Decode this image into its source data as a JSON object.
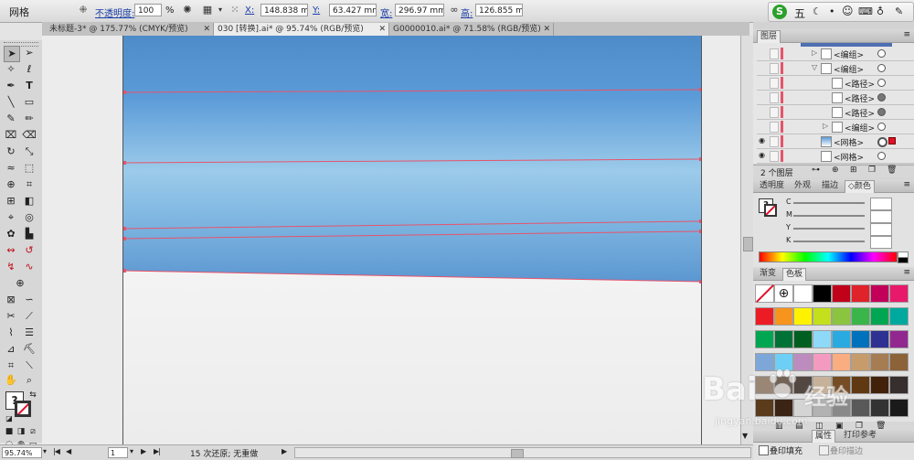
{
  "control_bar": {
    "tool_name": "网格",
    "opacity_label": "不透明度:",
    "opacity_value": "100",
    "percent_sign": "%",
    "x_label": "X:",
    "x_value": "148.838 mm",
    "y_label": "Y:",
    "y_value": "63.427 mm",
    "width_label": "宽:",
    "width_value": "296.97 mm",
    "height_label": "高:",
    "height_value": "126.855 mm"
  },
  "ime_bar": {
    "logo": "S",
    "mode": "五",
    "icons": [
      "moon-icon",
      "dot-icon",
      "smiley-icon",
      "keyboard-icon",
      "shirt-icon",
      "wrench-icon"
    ]
  },
  "document_tabs": [
    {
      "title": "未标题-3* @ 175.77% (CMYK/预览)",
      "active": false
    },
    {
      "title": "030 [转换].ai* @ 95.74% (RGB/预览)",
      "active": true
    },
    {
      "title": "G0000010.ai* @ 71.58% (RGB/预览)",
      "active": false
    }
  ],
  "layers_panel": {
    "title": "图层",
    "rows": [
      {
        "name": "<编组>",
        "indent": 1,
        "twirl": "▷",
        "visible": false,
        "target": "ring"
      },
      {
        "name": "<编组>",
        "indent": 1,
        "twirl": "▽",
        "visible": false,
        "target": "ring"
      },
      {
        "name": "<路径>",
        "indent": 2,
        "twirl": "",
        "visible": false,
        "target": "ring"
      },
      {
        "name": "<路径>",
        "indent": 2,
        "twirl": "",
        "visible": false,
        "target": "filled"
      },
      {
        "name": "<路径>",
        "indent": 2,
        "twirl": "",
        "visible": false,
        "target": "filled"
      },
      {
        "name": "<编组>",
        "indent": 2,
        "twirl": "▷",
        "visible": false,
        "target": "ring"
      },
      {
        "name": "<网格>",
        "indent": 1,
        "twirl": "",
        "visible": true,
        "target": "selected"
      },
      {
        "name": "<网格>",
        "indent": 1,
        "twirl": "",
        "visible": true,
        "target": "ring"
      }
    ],
    "footer_count": "2 个图层"
  },
  "color_panel": {
    "tabs": [
      "透明度",
      "外观",
      "描边",
      "颜色"
    ],
    "active_tab": "颜色",
    "channels": [
      "C",
      "M",
      "Y",
      "K"
    ]
  },
  "swatches_panel": {
    "tabs": [
      "渐变",
      "色板"
    ],
    "active_tab": "色板",
    "colors": [
      "none",
      "registration",
      "#ffffff",
      "#000000",
      "#c1001a",
      "#e0222a",
      "#c2005a",
      "#e8196b",
      "#ec1c24",
      "#f7941d",
      "#fff200",
      "#c4df1b",
      "#8bc53f",
      "#39b54a",
      "#00a651",
      "#00a99d",
      "#00a651",
      "#007236",
      "#005e20",
      "#8ed8f8",
      "#29abe2",
      "#0071bc",
      "#2e3192",
      "#92278f",
      "#7da7d9",
      "#6dcff6",
      "#bd8cbf",
      "#f49ac1",
      "#f9ad81",
      "#c69c6d",
      "#a67c52",
      "#8c6239",
      "#998675",
      "#736357",
      "#534741",
      "#c7b299",
      "#754c24",
      "#603913",
      "#42210b",
      "#362f2d",
      "#5a3b1c",
      "#3c2415",
      "#d4d4d4",
      "#b2b2b2",
      "#898989",
      "#595959",
      "#333333",
      "#1a1a1a"
    ]
  },
  "attributes_panel": {
    "tabs": [
      "属性",
      "打印参考"
    ],
    "overprint_fill_label": "叠印填充",
    "overprint_stroke_label": "叠印描边"
  },
  "status_bar": {
    "zoom": "95.74%",
    "page": "1",
    "undo_text": "15 次还原; 无重做"
  },
  "watermark": {
    "brand": "Bai",
    "brand2": "经验",
    "url": "jingyan.baidu.com"
  }
}
